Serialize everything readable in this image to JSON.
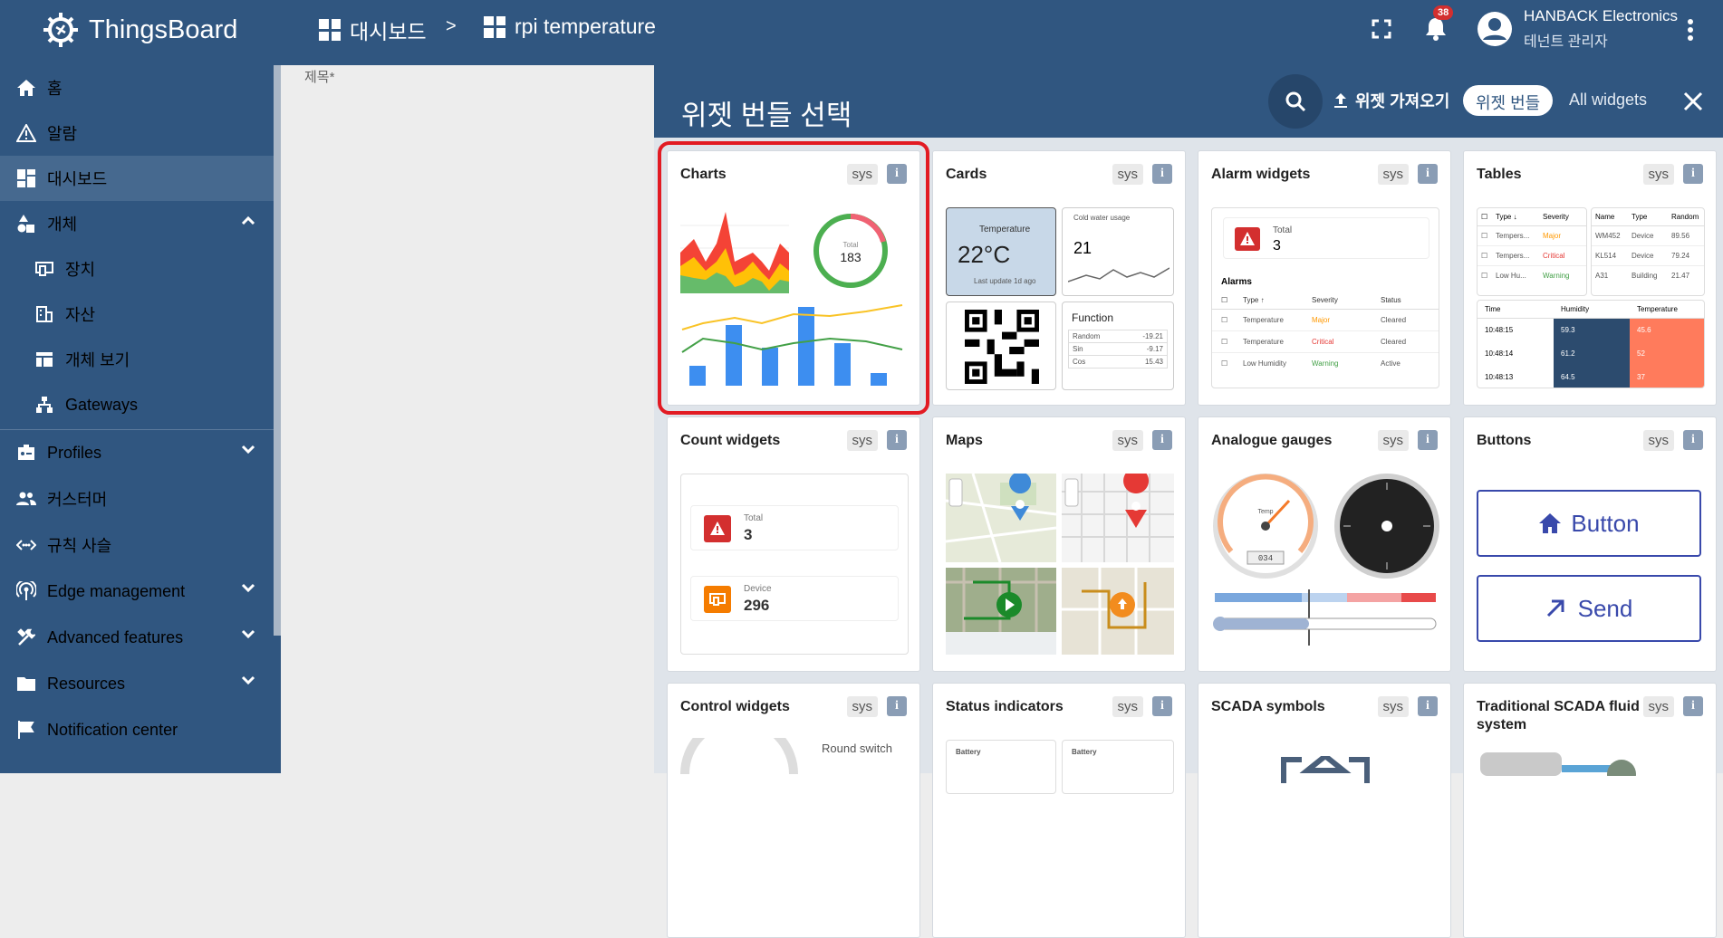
{
  "app": {
    "name": "ThingsBoard"
  },
  "breadcrumb": {
    "item1": "대시보드",
    "sep": ">",
    "item2": "rpi temperature"
  },
  "notifications": {
    "count": "38"
  },
  "user": {
    "name": "HANBACK Electronics",
    "role": "테넌트 관리자"
  },
  "sidebar": {
    "items": [
      {
        "label": "홈",
        "icon": "home-icon"
      },
      {
        "label": "알람",
        "icon": "warning-icon"
      },
      {
        "label": "대시보드",
        "icon": "dashboard-icon"
      },
      {
        "label": "개체",
        "icon": "entities-icon"
      },
      {
        "label": "장치",
        "icon": "device-icon"
      },
      {
        "label": "자산",
        "icon": "asset-icon"
      },
      {
        "label": "개체 보기",
        "icon": "entity-view-icon"
      },
      {
        "label": "Gateways",
        "icon": "gateway-icon"
      },
      {
        "label": "Profiles",
        "icon": "profile-icon"
      },
      {
        "label": "커스터머",
        "icon": "customers-icon"
      },
      {
        "label": "규칙 사슬",
        "icon": "rule-chain-icon"
      },
      {
        "label": "Edge management",
        "icon": "edge-icon"
      },
      {
        "label": "Advanced features",
        "icon": "tools-icon"
      },
      {
        "label": "Resources",
        "icon": "folder-icon"
      },
      {
        "label": "Notification center",
        "icon": "flag-icon"
      }
    ]
  },
  "form": {
    "title_label": "제목*"
  },
  "dialog": {
    "title": "위젯 번들 선택",
    "import_label": "위젯 가져오기",
    "toggle_active": "위젯 번들",
    "toggle_other": "All widgets"
  },
  "bundles": [
    {
      "title": "Charts",
      "tag": "sys",
      "info": "i"
    },
    {
      "title": "Cards",
      "tag": "sys",
      "info": "i"
    },
    {
      "title": "Alarm widgets",
      "tag": "sys",
      "info": "i"
    },
    {
      "title": "Tables",
      "tag": "sys",
      "info": "i"
    },
    {
      "title": "Count widgets",
      "tag": "sys",
      "info": "i"
    },
    {
      "title": "Maps",
      "tag": "sys",
      "info": "i"
    },
    {
      "title": "Analogue gauges",
      "tag": "sys",
      "info": "i"
    },
    {
      "title": "Buttons",
      "tag": "sys",
      "info": "i"
    },
    {
      "title": "Control widgets",
      "tag": "sys",
      "info": "i"
    },
    {
      "title": "Status indicators",
      "tag": "sys",
      "info": "i"
    },
    {
      "title": "SCADA symbols",
      "tag": "sys",
      "info": "i"
    },
    {
      "title": "Traditional SCADA fluid system",
      "tag": "sys",
      "info": "i"
    }
  ],
  "previews": {
    "charts": {
      "total_label": "Total",
      "total_value": "183"
    },
    "cards": {
      "temp_label": "Temperature",
      "temp_value": "22°C",
      "temp_sub": "Last update 1d ago",
      "water_title": "Cold water usage",
      "water_value": "21",
      "function_title": "Function",
      "rows": [
        [
          "Random",
          "-19.21"
        ],
        [
          "Sin",
          "-9.17"
        ],
        [
          "Cos",
          "15.43"
        ]
      ]
    },
    "alarm": {
      "total_label": "Total",
      "total_value": "3",
      "alarms_label": "Alarms",
      "cols": [
        "Type ↑",
        "Severity",
        "Status"
      ],
      "rows": [
        [
          "Temperature",
          "Major",
          "Cleared"
        ],
        [
          "Temperature",
          "Critical",
          "Cleared"
        ],
        [
          "Low Humidity",
          "Warning",
          "Active"
        ]
      ]
    },
    "tables": {
      "cols1": [
        "Type ↓",
        "Severity"
      ],
      "rows1": [
        [
          "Tempers...",
          "Major"
        ],
        [
          "Tempers...",
          "Critical"
        ],
        [
          "Low Hu...",
          "Warning"
        ]
      ],
      "cols2": [
        "Name",
        "Type",
        "Random"
      ],
      "rows2": [
        [
          "WM452",
          "Device",
          "89.56"
        ],
        [
          "KL514",
          "Device",
          "79.24"
        ],
        [
          "A31",
          "Building",
          "21.47"
        ]
      ],
      "cols3": [
        "Time",
        "Humidity",
        "Temperature"
      ],
      "rows3": [
        [
          "10:48:15",
          "59.3",
          "45.6"
        ],
        [
          "10:48:14",
          "61.2",
          "52"
        ],
        [
          "10:48:13",
          "64.5",
          "37"
        ]
      ]
    },
    "count": {
      "a_label": "Total",
      "a_value": "3",
      "b_label": "Device",
      "b_value": "296"
    },
    "gauges": {
      "dial_label": "Temp",
      "dial_readout": "034"
    },
    "buttons": {
      "button1": "Button",
      "button2": "Send"
    },
    "control": {
      "switch_label": "Round switch"
    },
    "status": {
      "battery1": "Battery",
      "battery2": "Battery"
    }
  },
  "colors": {
    "primary": "#305680",
    "sidebar_active": "#46698f",
    "selection": "#e21b23",
    "button_blue": "#3949ab"
  }
}
